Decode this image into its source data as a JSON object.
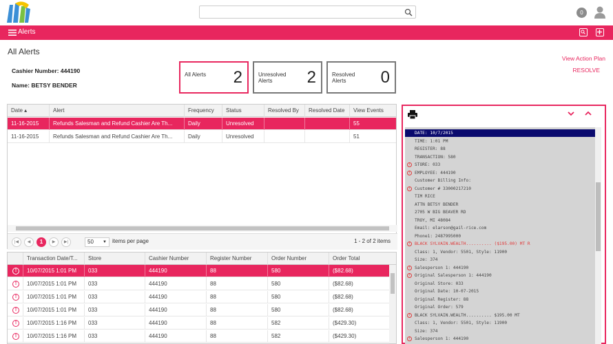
{
  "header": {
    "search_placeholder": "",
    "notification_count": "0"
  },
  "toolbar": {
    "title": "Alerts"
  },
  "page": {
    "title": "All Alerts",
    "cashier_label": "Cashier Number: 444190",
    "name_label": "Name: BETSY BENDER"
  },
  "cards": [
    {
      "label": "All Alerts",
      "value": "2"
    },
    {
      "label": "Unresolved Alerts",
      "value": "2"
    },
    {
      "label": "Resolved Alerts",
      "value": "0"
    }
  ],
  "links": {
    "view_action_plan": "View Action Plan",
    "resolve": "RESOLVE"
  },
  "alerts_table": {
    "columns": [
      "Date ▴",
      "Alert",
      "Frequency",
      "Status",
      "Resolved By",
      "Resolved Date",
      "View Events"
    ],
    "rows": [
      [
        "11-16-2015",
        "Refunds Salesman and Refund Cashier Are Th...",
        "Daily",
        "Unresolved",
        "",
        "",
        "55"
      ],
      [
        "11-16-2015",
        "Refunds Salesman and Refund Cashier Are Th...",
        "Daily",
        "Unresolved",
        "",
        "",
        "51"
      ]
    ]
  },
  "pager": {
    "current_page": "1",
    "page_size": "50",
    "items_per_page_label": "items per page",
    "summary": "1 - 2 of 2 items"
  },
  "transactions_table": {
    "columns": [
      "",
      "Transaction Date/T...",
      "Store",
      "Cashier Number",
      "Register Number",
      "Order Number",
      "Order Total"
    ],
    "rows": [
      [
        "10/07/2015 1:01 PM",
        "033",
        "444190",
        "88",
        "580",
        "($82.68)"
      ],
      [
        "10/07/2015 1:01 PM",
        "033",
        "444190",
        "88",
        "580",
        "($82.68)"
      ],
      [
        "10/07/2015 1:01 PM",
        "033",
        "444190",
        "88",
        "580",
        "($82.68)"
      ],
      [
        "10/07/2015 1:01 PM",
        "033",
        "444190",
        "88",
        "580",
        "($82.68)"
      ],
      [
        "10/07/2015 1:16 PM",
        "033",
        "444190",
        "88",
        "582",
        "($429.30)"
      ],
      [
        "10/07/2015 1:16 PM",
        "033",
        "444190",
        "88",
        "582",
        "($429.30)"
      ]
    ]
  },
  "receipt": {
    "lines": [
      {
        "text": "DATE: 10/7/2015",
        "style": "hl",
        "icon": false
      },
      {
        "text": "TIME: 1:01 PM",
        "style": "",
        "icon": false
      },
      {
        "text": "REGISTER: 88",
        "style": "",
        "icon": false
      },
      {
        "text": "TRANSACTION: 580",
        "style": "",
        "icon": false
      },
      {
        "text": "STORE: 033",
        "style": "",
        "icon": true
      },
      {
        "text": "EMPLOYEE: 444190",
        "style": "",
        "icon": true
      },
      {
        "text": "Customer Billing Info:",
        "style": "",
        "icon": false
      },
      {
        "text": "Customer # 33000217210",
        "style": "",
        "icon": true
      },
      {
        "text": "TIM RICE",
        "style": "",
        "icon": false
      },
      {
        "text": "ATTN BETSY BENDER",
        "style": "",
        "icon": false
      },
      {
        "text": "2705 W BIG BEAVER RD",
        "style": "",
        "icon": false
      },
      {
        "text": "TROY, MI 48084",
        "style": "",
        "icon": false
      },
      {
        "text": "Email: elarson@gail-rice.com",
        "style": "",
        "icon": false
      },
      {
        "text": "Phone1: 2487995000",
        "style": "",
        "icon": false
      },
      {
        "text": "BLACK SYLVAIN.WEALTH.......... ($195.00) MT R",
        "style": "red",
        "icon": true
      },
      {
        "text": "Class: 1, Vendor: 5501, Style: 11900",
        "style": "",
        "icon": false
      },
      {
        "text": "Size: 374",
        "style": "",
        "icon": false
      },
      {
        "text": "Salesperson 1: 444190",
        "style": "",
        "icon": true
      },
      {
        "text": "Original Salesperson 1: 444190",
        "style": "",
        "icon": true
      },
      {
        "text": "Original Store: 033",
        "style": "",
        "icon": false
      },
      {
        "text": "Original Date: 10-07-2015",
        "style": "",
        "icon": false
      },
      {
        "text": "Original Register: 88",
        "style": "",
        "icon": false
      },
      {
        "text": "Original Order: 579",
        "style": "",
        "icon": false
      },
      {
        "text": "BLACK SYLVAIN.WEALTH.......... $195.00 MT",
        "style": "",
        "icon": true
      },
      {
        "text": "Class: 1, Vendor: 5501, Style: 11900",
        "style": "",
        "icon": false
      },
      {
        "text": "Size: 374",
        "style": "",
        "icon": false
      },
      {
        "text": "Salesperson 1: 444190",
        "style": "",
        "icon": true
      }
    ]
  },
  "colors": {
    "accent": "#e8265e",
    "receipt_bg": "#d4d4d4",
    "highlight": "#0a0a6e"
  }
}
